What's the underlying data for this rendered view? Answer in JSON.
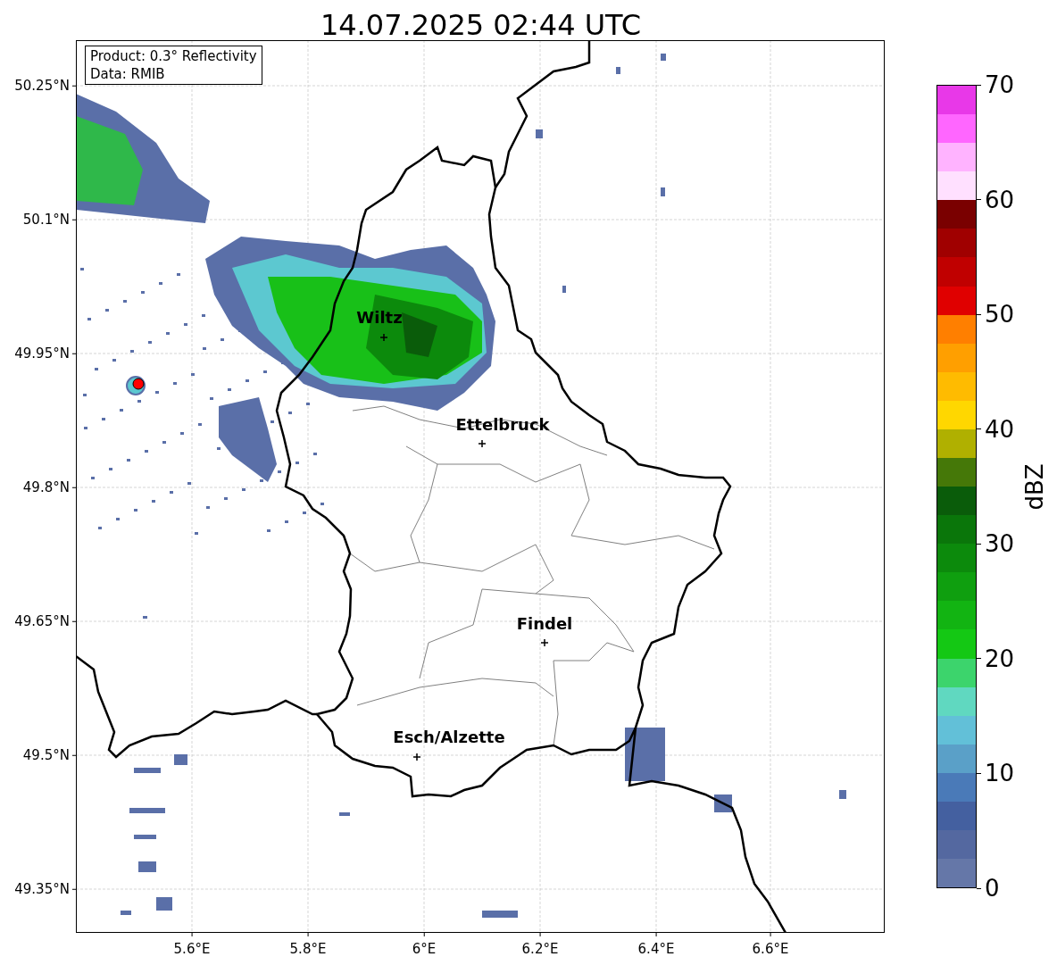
{
  "title": "14.07.2025 02:44 UTC",
  "info_box": [
    "Product: 0.3° Reflectivity",
    "Data: RMIB"
  ],
  "cities": [
    {
      "name": "Wiltz"
    },
    {
      "name": "Ettelbruck"
    },
    {
      "name": "Findel"
    },
    {
      "name": "Esch/Alzette"
    }
  ],
  "lat_ticks": [
    "50.25°N",
    "50.1°N",
    "49.95°N",
    "49.8°N",
    "49.65°N",
    "49.5°N",
    "49.35°N"
  ],
  "lon_ticks": [
    "5.6°E",
    "5.8°E",
    "6°E",
    "6.2°E",
    "6.4°E",
    "6.6°E"
  ],
  "colorbar": {
    "label": "dBZ",
    "ticks": [
      "70",
      "60",
      "50",
      "40",
      "30",
      "20",
      "10",
      "0"
    ],
    "segments": [
      {
        "color": "#e838e8"
      },
      {
        "color": "#ff66ff"
      },
      {
        "color": "#ffb3ff"
      },
      {
        "color": "#ffe0ff"
      },
      {
        "color": "#7a0000"
      },
      {
        "color": "#a00000"
      },
      {
        "color": "#c00000"
      },
      {
        "color": "#e00000"
      },
      {
        "color": "#ff7f00"
      },
      {
        "color": "#ff9f00"
      },
      {
        "color": "#ffbb00"
      },
      {
        "color": "#ffd700"
      },
      {
        "color": "#b0b000"
      },
      {
        "color": "#457808"
      },
      {
        "color": "#0a5c0a"
      },
      {
        "color": "#0a760a"
      },
      {
        "color": "#0c8a0c"
      },
      {
        "color": "#0f9f0f"
      },
      {
        "color": "#12b412"
      },
      {
        "color": "#14c814"
      },
      {
        "color": "#3cd46c"
      },
      {
        "color": "#60d8c0"
      },
      {
        "color": "#62c0d8"
      },
      {
        "color": "#5aa0c8"
      },
      {
        "color": "#4a7ab8"
      },
      {
        "color": "#4460a0"
      },
      {
        "color": "#5468a0"
      },
      {
        "color": "#6577a8"
      }
    ]
  }
}
